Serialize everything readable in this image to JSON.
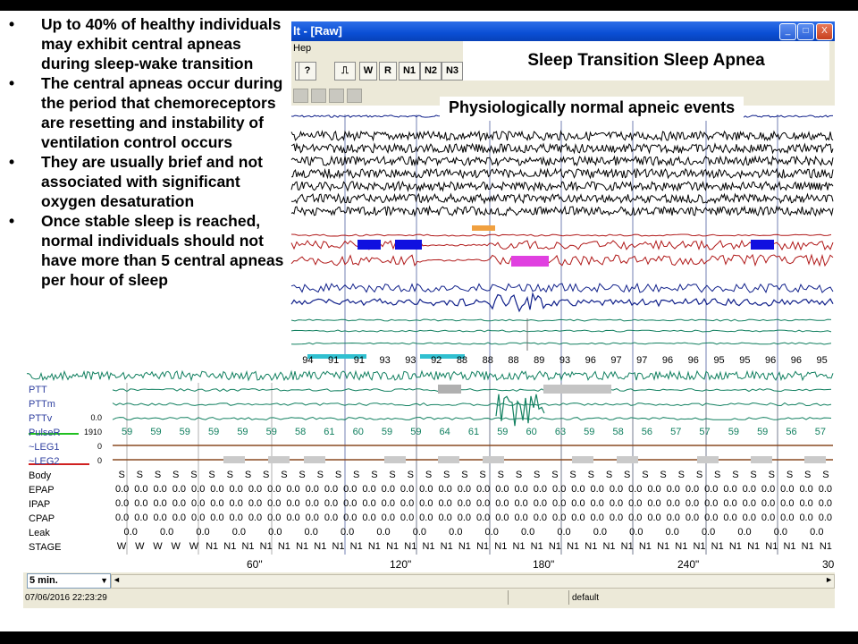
{
  "slide": {
    "bullets": [
      "Up to 40% of healthy individuals may exhibit central apneas during sleep-wake transition",
      "The central apneas occur during the period that chemoreceptors are resetting and instability of ventilation control occurs",
      "They are usually brief and not associated with significant oxygen desaturation",
      "Once stable sleep is reached, normal individuals should not have more than 5 central apneas per hour of sleep"
    ],
    "callout_title": "Sleep Transition Sleep Apnea",
    "callout_subtitle": "Physiologically normal apneic events"
  },
  "window": {
    "title": "lt - [Raw]",
    "menu_help": "Hep",
    "buttons": {
      "minimize": "_",
      "maximize": "□",
      "close": "X"
    }
  },
  "toolbar": {
    "help_glyph": "?",
    "stage_buttons": [
      "W",
      "R",
      "N1",
      "N2",
      "N3"
    ]
  },
  "channels": [
    {
      "name": "PTT",
      "scale": ""
    },
    {
      "name": "PTTm",
      "scale": ""
    },
    {
      "name": "PTTv",
      "scale": "0.0"
    },
    {
      "name": "PulseR",
      "scale": "1910"
    },
    {
      "name": "~LEG1",
      "scale": "0"
    },
    {
      "name": "~LEG2",
      "scale": "0"
    },
    {
      "name": "Body",
      "scale": ""
    },
    {
      "name": "EPAP",
      "scale": ""
    },
    {
      "name": "IPAP",
      "scale": ""
    },
    {
      "name": "CPAP",
      "scale": ""
    },
    {
      "name": "Leak",
      "scale": ""
    },
    {
      "name": "STAGE",
      "scale": ""
    }
  ],
  "spo2_values": [
    "94",
    "91",
    "91",
    "93",
    "93",
    "92",
    "88",
    "88",
    "88",
    "89",
    "93",
    "96",
    "97",
    "97",
    "96",
    "96",
    "95",
    "95",
    "96",
    "96",
    "95"
  ],
  "pulse_values": [
    "59",
    "59",
    "59",
    "59",
    "59",
    "59",
    "58",
    "61",
    "60",
    "59",
    "59",
    "64",
    "61",
    "59",
    "60",
    "63",
    "59",
    "58",
    "56",
    "57",
    "57",
    "59",
    "59",
    "56",
    "57"
  ],
  "body_values": [
    "S",
    "S",
    "S",
    "S",
    "S",
    "S",
    "S",
    "S",
    "S",
    "S",
    "S",
    "S",
    "S",
    "S",
    "S",
    "S",
    "S",
    "S",
    "S",
    "S",
    "S",
    "S",
    "S",
    "S",
    "S",
    "S",
    "S",
    "S",
    "S",
    "S",
    "S",
    "S",
    "S",
    "S",
    "S",
    "S",
    "S",
    "S",
    "S",
    "S"
  ],
  "pressure_value": "0.0",
  "stage_values": [
    "W",
    "W",
    "W",
    "W",
    "W",
    "N1",
    "N1",
    "N1",
    "N1",
    "N1",
    "N1",
    "N1",
    "N1",
    "N1",
    "N1",
    "N1",
    "N1",
    "N1",
    "N1",
    "N1",
    "N1",
    "N1",
    "N1",
    "N1",
    "N1",
    "N1",
    "N1",
    "N1",
    "N1",
    "N1",
    "N1",
    "N1",
    "N1",
    "N1",
    "N1",
    "N1",
    "N1",
    "N1",
    "N1",
    "N1"
  ],
  "time_labels": [
    "60\"",
    "120\"",
    "180\"",
    "240\"",
    "30"
  ],
  "bottom": {
    "epoch_option": "5 min.",
    "timestamp": "07/06/2016 22:23:29",
    "montage": "default"
  },
  "colors": {
    "eeg": "#000000",
    "respiratory_red": "#b01818",
    "respiratory_blue": "#10208a",
    "green": "#128060",
    "cyan_bar": "#30c0d0",
    "orange_mark": "#f0a040",
    "magenta_mark": "#e040e0",
    "event_blue": "#1010e0"
  }
}
